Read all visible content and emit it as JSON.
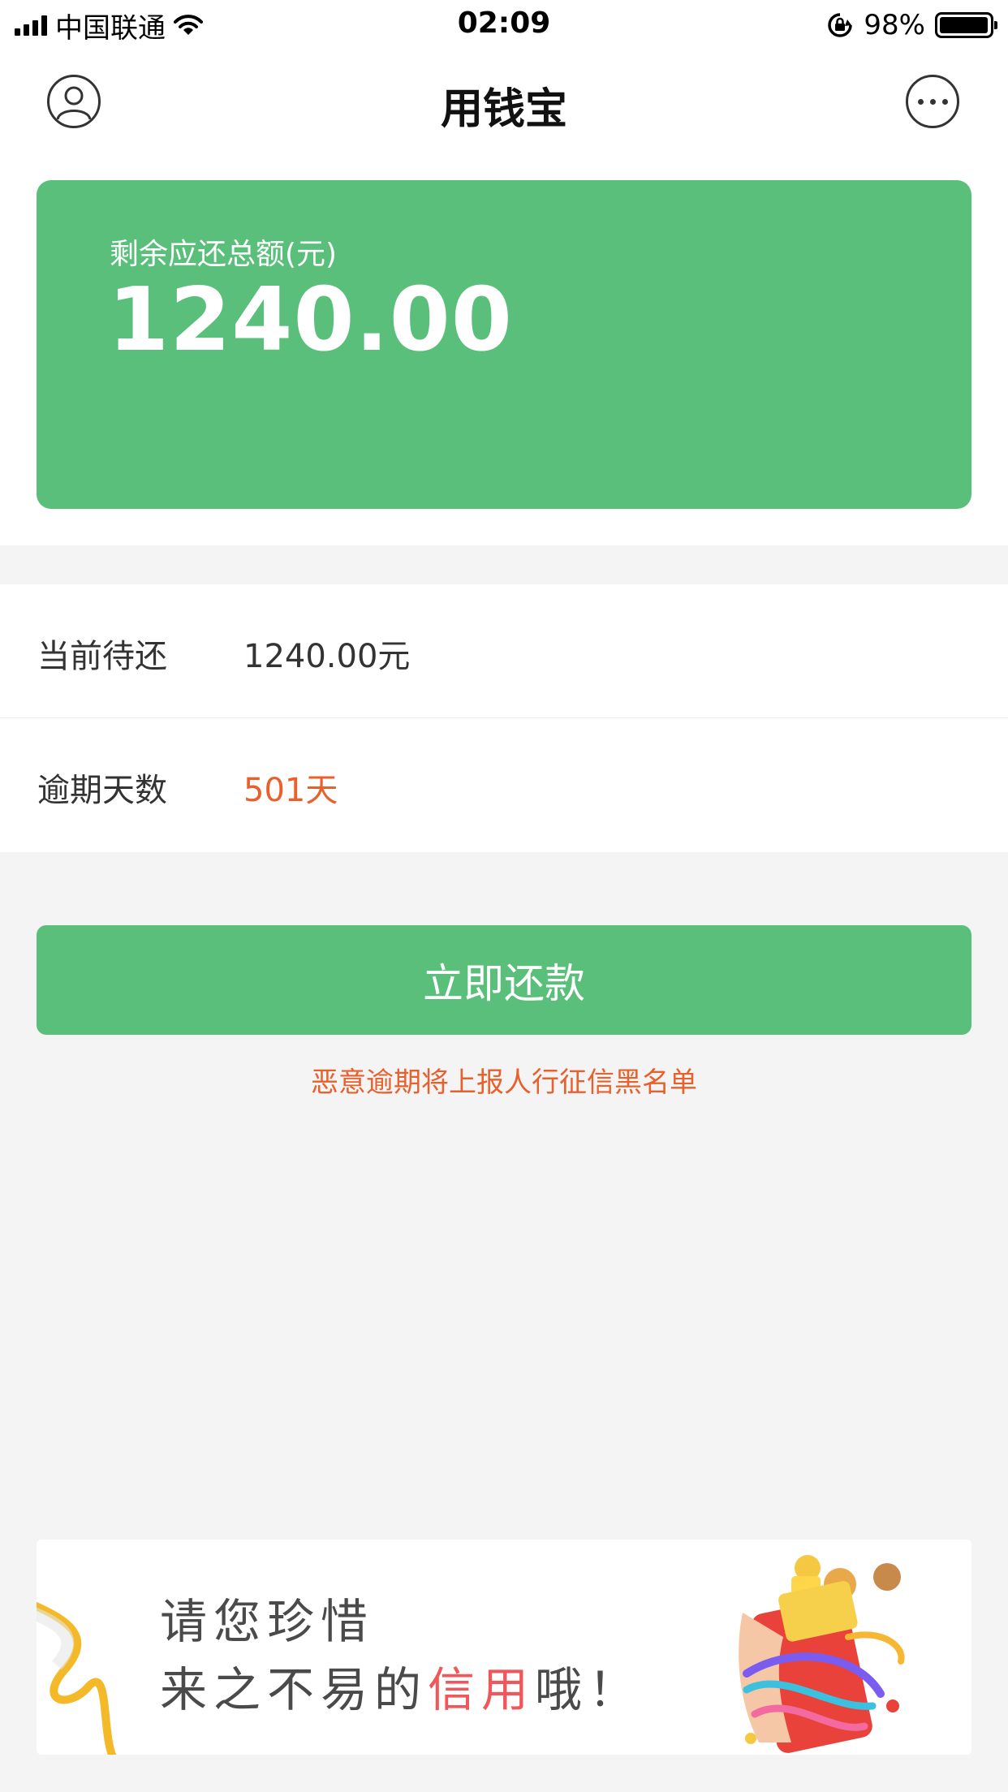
{
  "status_bar": {
    "carrier": "中国联通",
    "time": "02:09",
    "battery_text": "98%",
    "battery_level": 0.98
  },
  "nav": {
    "title": "用钱宝",
    "avatar_icon": "user-avatar-icon",
    "more_icon": "more-dots-icon"
  },
  "balance": {
    "label": "剩余应还总额(元)",
    "amount": "1240.00"
  },
  "details": [
    {
      "label": "当前待还",
      "value": "1240.00元"
    },
    {
      "label": "逾期天数",
      "value": "501天"
    }
  ],
  "repay": {
    "button_label": "立即还款",
    "warning": "恶意逾期将上报人行征信黑名单"
  },
  "banner": {
    "line1": "请您珍惜",
    "line2_prefix": "来之不易的",
    "line2_highlight": "信用",
    "line2_suffix": "哦！"
  },
  "colors": {
    "accent": "#59bf7b",
    "warning": "#e8602c",
    "highlight": "#f0575a",
    "background": "#f4f4f4"
  }
}
